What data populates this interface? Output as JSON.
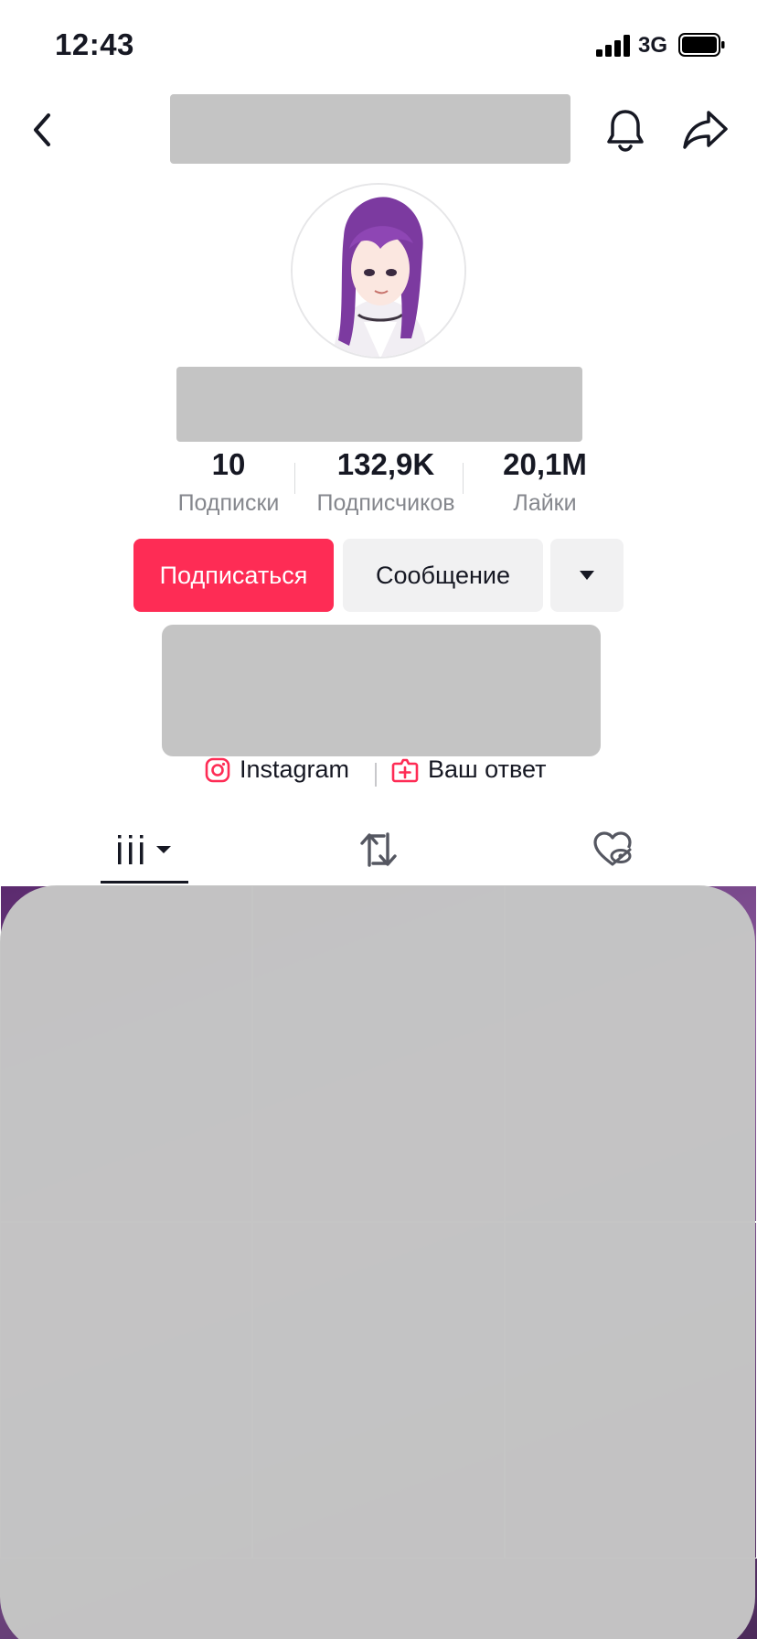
{
  "status_bar": {
    "time": "12:43",
    "network": "3G"
  },
  "profile": {
    "stats": [
      {
        "value": "10",
        "label": "Подписки"
      },
      {
        "value": "132,9K",
        "label": "Подписчиков"
      },
      {
        "value": "20,1M",
        "label": "Лайки"
      }
    ],
    "buttons": {
      "follow": "Подписаться",
      "message": "Сообщение"
    },
    "links": {
      "instagram": "Instagram",
      "reply": "Ваш ответ"
    }
  },
  "colors": {
    "accent": "#fe2c55",
    "redacted": "#c4c4c4",
    "secondary_button": "#f1f1f2",
    "muted_text": "#85878d"
  },
  "icons": [
    "back-icon",
    "bell-icon",
    "share-icon",
    "dropdown-arrow-icon",
    "instagram-icon",
    "reply-icon",
    "videos-grid-icon",
    "reposts-icon",
    "liked-hidden-icon"
  ]
}
